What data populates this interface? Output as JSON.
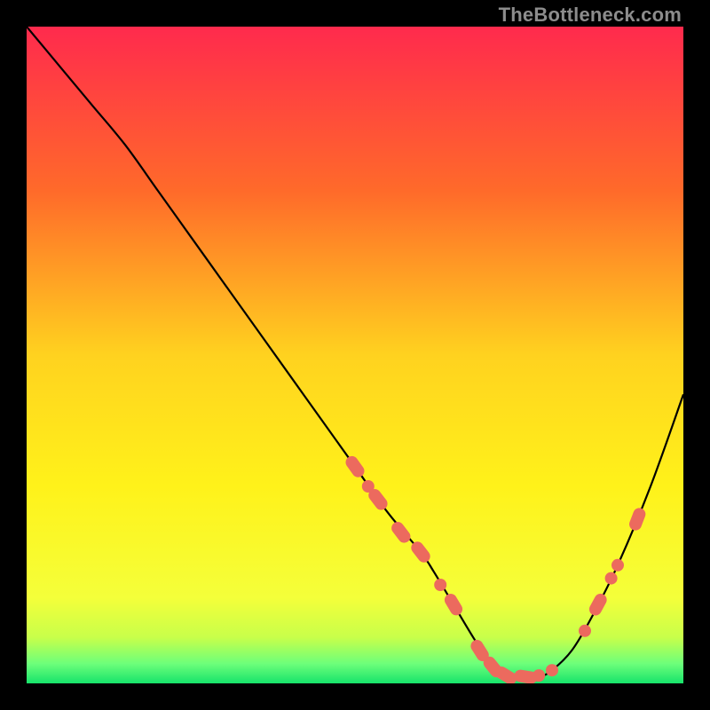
{
  "attribution": "TheBottleneck.com",
  "chart_data": {
    "type": "line",
    "title": "",
    "xlabel": "",
    "ylabel": "",
    "xlim": [
      0,
      100
    ],
    "ylim": [
      0,
      100
    ],
    "gradient_stops": [
      {
        "offset": 0.0,
        "color": "#ff2a4d"
      },
      {
        "offset": 0.25,
        "color": "#ff6a2a"
      },
      {
        "offset": 0.5,
        "color": "#ffd21f"
      },
      {
        "offset": 0.7,
        "color": "#fff21a"
      },
      {
        "offset": 0.87,
        "color": "#f4ff3a"
      },
      {
        "offset": 0.93,
        "color": "#c8ff4a"
      },
      {
        "offset": 0.97,
        "color": "#6dff7a"
      },
      {
        "offset": 1.0,
        "color": "#17e36b"
      }
    ],
    "curve": {
      "x": [
        0,
        5,
        10,
        15,
        20,
        25,
        30,
        35,
        40,
        45,
        50,
        55,
        60,
        62,
        65,
        68,
        70,
        72,
        75,
        78,
        80,
        83,
        86,
        90,
        95,
        100
      ],
      "y": [
        100,
        94,
        88,
        82,
        75,
        68,
        61,
        54,
        47,
        40,
        33,
        26,
        20,
        17,
        12,
        7,
        4,
        2,
        1,
        1,
        2,
        5,
        10,
        18,
        30,
        44
      ]
    },
    "markers": [
      {
        "x": 50,
        "y": 33,
        "style": "lozenge"
      },
      {
        "x": 52,
        "y": 30,
        "style": "dot"
      },
      {
        "x": 53.5,
        "y": 28,
        "style": "lozenge"
      },
      {
        "x": 57,
        "y": 23,
        "style": "lozenge"
      },
      {
        "x": 60,
        "y": 20,
        "style": "lozenge"
      },
      {
        "x": 63,
        "y": 15,
        "style": "dot"
      },
      {
        "x": 65,
        "y": 12,
        "style": "lozenge"
      },
      {
        "x": 69,
        "y": 5,
        "style": "lozenge"
      },
      {
        "x": 71,
        "y": 2.5,
        "style": "lozenge"
      },
      {
        "x": 73,
        "y": 1.2,
        "style": "lozenge"
      },
      {
        "x": 76,
        "y": 1.0,
        "style": "lozenge"
      },
      {
        "x": 78,
        "y": 1.2,
        "style": "dot"
      },
      {
        "x": 80,
        "y": 2.0,
        "style": "dot"
      },
      {
        "x": 85,
        "y": 8,
        "style": "dot"
      },
      {
        "x": 87,
        "y": 12,
        "style": "lozenge"
      },
      {
        "x": 89,
        "y": 16,
        "style": "dot"
      },
      {
        "x": 90,
        "y": 18,
        "style": "dot"
      },
      {
        "x": 93,
        "y": 25,
        "style": "lozenge"
      }
    ],
    "marker_color": "#ec6a5e",
    "curve_color": "#000000"
  }
}
